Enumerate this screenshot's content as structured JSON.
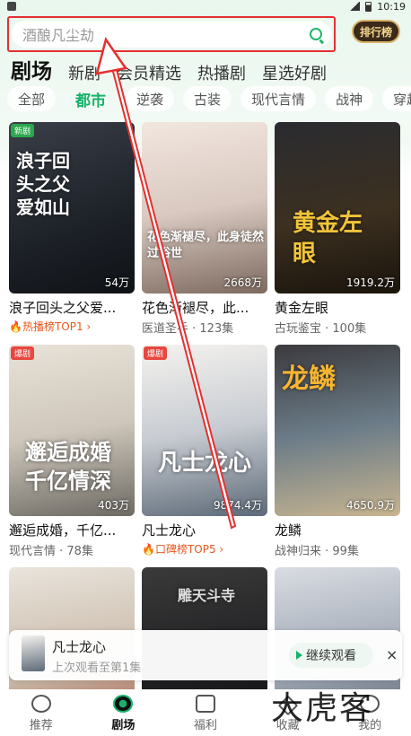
{
  "status": {
    "time": "10:19"
  },
  "search": {
    "placeholder": "酒酿凡尘劫"
  },
  "ranking": {
    "label": "排行榜"
  },
  "main_tabs": [
    "剧场",
    "新剧",
    "会员精选",
    "热播剧",
    "星选好剧"
  ],
  "sub_tabs": [
    "全部",
    "都市",
    "逆袭",
    "古装",
    "现代言情",
    "战神",
    "穿越"
  ],
  "cards": [
    {
      "title": "浪子回头之父爱...",
      "art": "浪子回头之父爱如山",
      "views": "54万",
      "badge": "新剧",
      "sub": "",
      "rank": "热播榜TOP1"
    },
    {
      "title": "花色渐褪尽，此...",
      "art": "花色渐褪尽，此身徒然过俗世",
      "views": "2668万",
      "badge": "",
      "sub": "医道圣手 · 123集",
      "rank": ""
    },
    {
      "title": "黄金左眼",
      "art": "黄金左眼",
      "views": "1919.2万",
      "badge": "",
      "sub": "古玩鉴宝 · 100集",
      "rank": ""
    },
    {
      "title": "邂逅成婚，千亿...",
      "art": "邂逅成婚千亿情深",
      "views": "403万",
      "badge": "爆剧",
      "sub": "现代言情 · 78集",
      "rank": ""
    },
    {
      "title": "凡士龙心",
      "art": "凡士龙心",
      "views": "9874.4万",
      "badge": "爆剧",
      "sub": "",
      "rank": "口碑榜TOP5"
    },
    {
      "title": "龙鳞",
      "art": "龙鳞",
      "views": "4650.9万",
      "badge": "",
      "sub": "战神归来 · 99集",
      "rank": ""
    },
    {
      "title": "",
      "art": "",
      "views": "",
      "badge": "",
      "sub": "",
      "rank": ""
    },
    {
      "title": "",
      "art": "雕天斗寺",
      "views": "",
      "badge": "",
      "sub": "",
      "rank": ""
    },
    {
      "title": "",
      "art": "",
      "views": "",
      "badge": "",
      "sub": "",
      "rank": ""
    }
  ],
  "continue": {
    "title": "凡士龙心",
    "subtitle": "上次观看至第1集",
    "button": "继续观看",
    "close": "×"
  },
  "bottom_nav": [
    "推荐",
    "剧场",
    "福利",
    "收藏",
    "我的"
  ],
  "watermark": "大虎客",
  "colors": {
    "accent": "#17b26a",
    "annotation": "#e53030"
  }
}
